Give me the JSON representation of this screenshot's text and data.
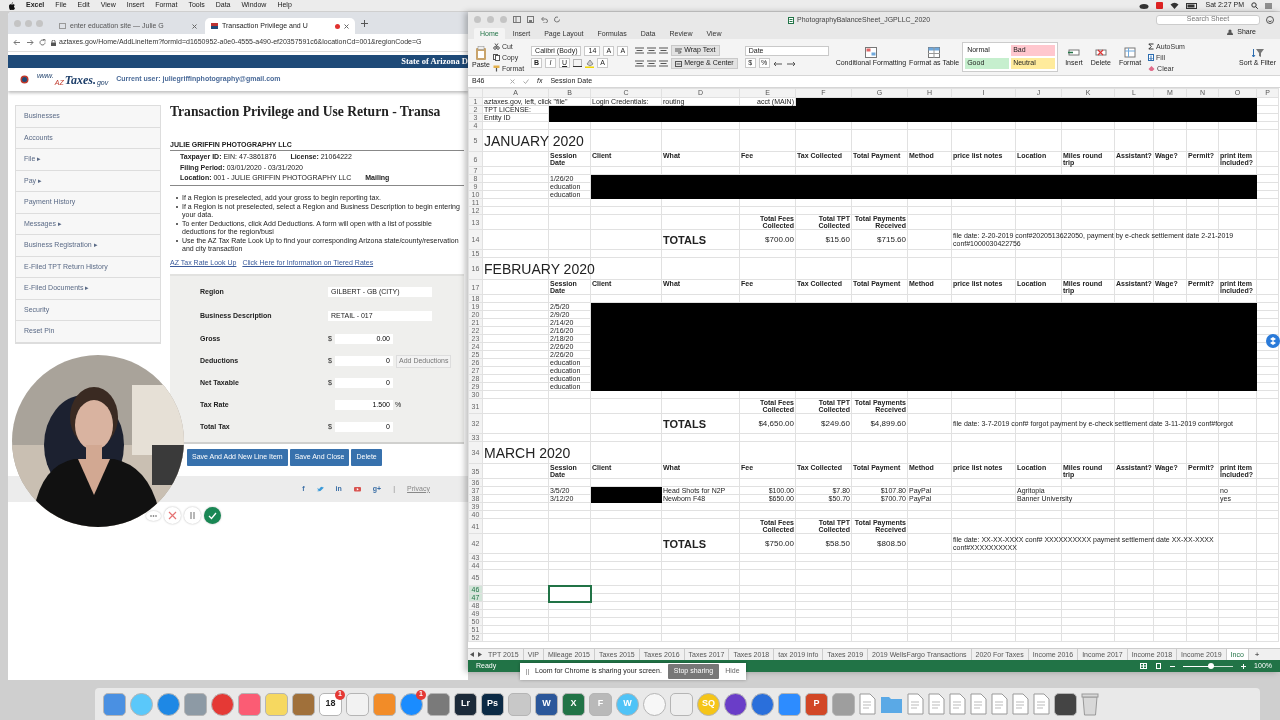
{
  "menubar": {
    "app": "Excel",
    "items": [
      "File",
      "Edit",
      "View",
      "Insert",
      "Format",
      "Tools",
      "Data",
      "Window",
      "Help"
    ],
    "clock": "Sat 2:27 PM"
  },
  "browser": {
    "tabs": [
      {
        "title": "enter education site — Julie G",
        "selected": false,
        "recording": false
      },
      {
        "title": "Transaction Privilege and U",
        "selected": true,
        "recording": true
      }
    ],
    "url": "aztaxes.gov/Home/AddLineItem?formId=d1650952-a0e0-4555-a490-ef20357591c6&locationCd=001&regionCode=G",
    "banner": "State of Arizona D",
    "logo": {
      "prefix": "www.",
      "mark": "AZ",
      "name": "Taxes.",
      "suffix": "gov"
    },
    "current_user": "Current user: juliegriffinphotography@gmail.com",
    "sidebar": [
      "Businesses",
      "Accounts",
      "File ▸",
      "Pay ▸",
      "Payment History",
      "Messages ▸",
      "Business Registration ▸",
      "E-Filed TPT Return History",
      "E-Filed Documents ▸",
      "Security",
      "Reset Pin"
    ],
    "page_title": "Transaction Privilege and Use Return - Transa",
    "business": "JULIE GRIFFIN PHOTOGRAPHY LLC",
    "info": [
      [
        {
          "label": "Taxpayer ID:",
          "value": "EIN: 47-3861876"
        },
        {
          "label": "License:",
          "value": "21064222"
        }
      ],
      [
        {
          "label": "Filing Period:",
          "value": "03/01/2020 - 03/31/2020"
        },
        {
          "label": "Location:",
          "value": "001 - JULIE GRIFFIN PHOTOGRAPHY LLC"
        },
        {
          "label": "Mailing"
        }
      ]
    ],
    "instructions": [
      "If a Region is preselected, add your gross to begin reporting tax.",
      "If a Region is not preselected, select a Region and Business Description to begin entering your data.",
      "To enter Deductions, click Add Deductions. A form will open with a list of possible deductions for the region/busi",
      "Use the AZ Tax Rate Look Up to find your corresponding Arizona state/county/reservation and city transaction"
    ],
    "links": [
      "AZ Tax Rate Look Up",
      "Click Here for Information on Tiered Rates"
    ],
    "selects": [
      {
        "label": "Region",
        "value": "GILBERT - GB (CITY)"
      },
      {
        "label": "Business Description",
        "value": "RETAIL - 017"
      }
    ],
    "amounts": [
      {
        "label": "Gross",
        "prefix": "$",
        "value": "0.00"
      },
      {
        "label": "Deductions",
        "prefix": "$",
        "value": "0",
        "action": "Add Deductions"
      },
      {
        "label": "Net Taxable",
        "prefix": "$",
        "value": "0"
      },
      {
        "label": "Tax Rate",
        "value": "1.500",
        "suffix": "%"
      },
      {
        "label": "Total Tax",
        "prefix": "$",
        "value": "0"
      }
    ],
    "buttons": [
      "Save And Add New Line Item",
      "Save And Close",
      "Delete"
    ],
    "social": [
      {
        "kind": "glyph",
        "text": "f"
      },
      {
        "kind": "bird"
      },
      {
        "kind": "glyph",
        "text": "in"
      },
      {
        "kind": "play"
      },
      {
        "kind": "glyph",
        "text": "g+"
      }
    ],
    "separator": "|",
    "privacy": "Privacy"
  },
  "recorder": {
    "kind": "picture",
    "controls": [
      {
        "kind": "more"
      },
      {
        "kind": "cancel"
      },
      {
        "kind": "pause"
      },
      {
        "kind": "done"
      }
    ]
  },
  "excel": {
    "title": "PhotographyBalanceSheet_JGPLLC_2020",
    "search": {
      "placeholder": "Search Sheet"
    },
    "tabs": [
      {
        "label": "Home",
        "selected": true
      },
      {
        "label": "Insert",
        "selected": false
      },
      {
        "label": "Page Layout",
        "selected": false
      },
      {
        "label": "Formulas",
        "selected": false
      },
      {
        "label": "Data",
        "selected": false
      },
      {
        "label": "Review",
        "selected": false
      },
      {
        "label": "View",
        "selected": false
      }
    ],
    "share": "Share",
    "clipboard": {
      "paste": "Paste",
      "items": [
        "Cut",
        "Copy",
        "Format"
      ]
    },
    "font": {
      "name": "Calibri (Body)",
      "size": "14",
      "grow": [
        "A",
        "A"
      ],
      "styles": [
        "B",
        "I",
        "U"
      ],
      "color_button": "A"
    },
    "alignment": {
      "wrap": "Wrap Text",
      "merge": "Merge & Center"
    },
    "number": {
      "format": "Date",
      "buttons": [
        "$",
        "%"
      ]
    },
    "styles": {
      "conditional": "Conditional Formatting",
      "table": "Format as Table",
      "cells": [
        {
          "label": "Normal",
          "color": "#ffffff"
        },
        {
          "label": "Bad",
          "color": "#ffc7ce"
        },
        {
          "label": "Good",
          "color": "#c6efce"
        },
        {
          "label": "Neutral",
          "color": "#ffeb9c"
        }
      ]
    },
    "cells": [
      "Insert",
      "Delete",
      "Format"
    ],
    "editing": {
      "autosum": "AutoSum",
      "fill": "Fill",
      "clear": "Clear",
      "sort": "Sort & Filter"
    },
    "name_box": "B46",
    "fx": "fx",
    "formula": "Session Date",
    "columns": [
      "A",
      "B",
      "C",
      "D",
      "E",
      "F",
      "G",
      "H",
      "I",
      "J",
      "K",
      "L",
      "M",
      "N",
      "O",
      "P"
    ],
    "selection": {
      "B": true
    },
    "rows": [
      {
        "n": "1",
        "kind": "data",
        "selected": false,
        "cells": {
          "A": "aztaxes.gov, left, click \"file\"",
          "C": "Login Credentials:",
          "D": "routing",
          "E": "acct (MAIN)"
        },
        "redacted": {
          "F": true,
          "O": true
        }
      },
      {
        "n": "2",
        "kind": "data",
        "selected": false,
        "cells": {
          "A": "TPT LICENSE:"
        },
        "redacted": {
          "B": true,
          "O": true
        }
      },
      {
        "n": "3",
        "kind": "data",
        "selected": false,
        "cells": {
          "A": "Entity ID"
        },
        "redacted": {
          "B": true,
          "O": true
        }
      },
      {
        "n": "4",
        "kind": "data",
        "selected": false,
        "cells": {}
      },
      {
        "n": "5",
        "kind": "title",
        "selected": false,
        "cells": {
          "A": "JANUARY 2020"
        }
      },
      {
        "n": "6",
        "kind": "header",
        "selected": false,
        "cells": {
          "B": "Session Date",
          "C": "Client",
          "D": "What",
          "E": "Fee",
          "F": "Tax Collected",
          "G": "Total Payment",
          "H": "Method",
          "I": "price list notes",
          "J": "Location",
          "K": "Miles round trip",
          "L": "Assistant?",
          "M": "Wage?",
          "N": "Permit?",
          "O": "print item included?"
        }
      },
      {
        "n": "7",
        "kind": "data",
        "selected": false,
        "cells": {}
      },
      {
        "n": "8",
        "kind": "data",
        "selected": false,
        "cells": {
          "B": "1/26/20"
        },
        "redacted": {
          "C": true,
          "O": true
        }
      },
      {
        "n": "9",
        "kind": "data",
        "selected": false,
        "cells": {
          "B": "education"
        },
        "redacted": {
          "C": true,
          "O": true
        }
      },
      {
        "n": "10",
        "kind": "data",
        "selected": false,
        "cells": {
          "B": "education"
        },
        "redacted": {
          "C": true,
          "O": true
        }
      },
      {
        "n": "11",
        "kind": "data",
        "selected": false,
        "cells": {}
      },
      {
        "n": "12",
        "kind": "data",
        "selected": false,
        "cells": {}
      },
      {
        "n": "13",
        "kind": "labels",
        "selected": false,
        "cells": {
          "E": "Total Fees Collected",
          "F": "Total TPT Collected",
          "G": "Total Payments Received"
        }
      },
      {
        "n": "14",
        "kind": "totals",
        "selected": false,
        "cells": {
          "D": "TOTALS",
          "E": "$700.00",
          "F": "$15.60",
          "G": "$715.60",
          "I": "file date:  2-20-2019 conf#2020513622050, payment by e-check settlement date 2-21-2019 conf#1000030422756"
        }
      },
      {
        "n": "15",
        "kind": "data",
        "selected": false,
        "cells": {}
      },
      {
        "n": "16",
        "kind": "title",
        "selected": false,
        "cells": {
          "A": "FEBRUARY 2020"
        }
      },
      {
        "n": "17",
        "kind": "header",
        "selected": false,
        "cells": {
          "B": "Session Date",
          "C": "Client",
          "D": "What",
          "E": "Fee",
          "F": "Tax Collected",
          "G": "Total Payment",
          "H": "Method",
          "I": "price list notes",
          "J": "Location",
          "K": "Miles round trip",
          "L": "Assistant?",
          "M": "Wage?",
          "N": "Permit?",
          "O": "print item included?"
        }
      },
      {
        "n": "18",
        "kind": "data",
        "selected": false,
        "cells": {}
      },
      {
        "n": "19",
        "kind": "data",
        "selected": false,
        "cells": {
          "B": "2/5/20"
        },
        "redacted": {
          "C": true,
          "O": true
        }
      },
      {
        "n": "20",
        "kind": "data",
        "selected": false,
        "cells": {
          "B": "2/9/20"
        },
        "redacted": {
          "C": true,
          "O": true
        }
      },
      {
        "n": "21",
        "kind": "data",
        "selected": false,
        "cells": {
          "B": "2/14/20"
        },
        "redacted": {
          "C": true,
          "O": true
        }
      },
      {
        "n": "22",
        "kind": "data",
        "selected": false,
        "cells": {
          "B": "2/16/20"
        },
        "redacted": {
          "C": true,
          "O": true
        }
      },
      {
        "n": "23",
        "kind": "data",
        "selected": false,
        "cells": {
          "B": "2/18/20"
        },
        "redacted": {
          "C": true,
          "O": true
        }
      },
      {
        "n": "24",
        "kind": "data",
        "selected": false,
        "cells": {
          "B": "2/26/20"
        },
        "redacted": {
          "C": true,
          "O": true
        }
      },
      {
        "n": "25",
        "kind": "data",
        "selected": false,
        "cells": {
          "B": "2/26/20"
        },
        "redacted": {
          "C": true,
          "O": true
        }
      },
      {
        "n": "26",
        "kind": "data",
        "selected": false,
        "cells": {
          "B": "education"
        },
        "redacted": {
          "C": true,
          "O": true
        }
      },
      {
        "n": "27",
        "kind": "data",
        "selected": false,
        "cells": {
          "B": "education"
        },
        "redacted": {
          "C": true,
          "O": true
        }
      },
      {
        "n": "28",
        "kind": "data",
        "selected": false,
        "cells": {
          "B": "education"
        },
        "redacted": {
          "C": true,
          "O": true
        }
      },
      {
        "n": "29",
        "kind": "data",
        "selected": false,
        "cells": {
          "B": "education"
        },
        "redacted": {
          "C": true,
          "O": true
        }
      },
      {
        "n": "30",
        "kind": "data",
        "selected": false,
        "cells": {}
      },
      {
        "n": "31",
        "kind": "labels",
        "selected": false,
        "cells": {
          "E": "Total Fees Collected",
          "F": "Total TPT Collected",
          "G": "Total Payments Received"
        }
      },
      {
        "n": "32",
        "kind": "totals",
        "selected": false,
        "cells": {
          "D": "TOTALS",
          "E": "$4,650.00",
          "F": "$249.60",
          "G": "$4,899.60",
          "I": "file date:  3-7-2019 conf# forgot  payment by e-check settlement date 3-11-2019 conf#forgot"
        }
      },
      {
        "n": "33",
        "kind": "data",
        "selected": false,
        "cells": {}
      },
      {
        "n": "34",
        "kind": "title",
        "selected": false,
        "cells": {
          "A": "MARCH 2020"
        }
      },
      {
        "n": "35",
        "kind": "header",
        "selected": false,
        "cells": {
          "B": "Session Date",
          "C": "Client",
          "D": "What",
          "E": "Fee",
          "F": "Tax Collected",
          "G": "Total Payment",
          "H": "Method",
          "I": "price list notes",
          "J": "Location",
          "K": "Miles round trip",
          "L": "Assistant?",
          "M": "Wage?",
          "N": "Permit?",
          "O": "print item included?"
        }
      },
      {
        "n": "36",
        "kind": "data",
        "selected": false,
        "cells": {}
      },
      {
        "n": "37",
        "kind": "data",
        "selected": false,
        "cells": {
          "B": "3/5/20",
          "D": "Head Shots for N2P",
          "E": "$100.00",
          "F": "$7.80",
          "G": "$107.80",
          "H": "PayPal",
          "J": "Agritopia",
          "O": "no"
        },
        "redacted": {
          "C": true
        }
      },
      {
        "n": "38",
        "kind": "data",
        "selected": false,
        "cells": {
          "B": "3/12/20",
          "D": "Newborn F48",
          "E": "$650.00",
          "F": "$50.70",
          "G": "$700.70",
          "H": "PayPal",
          "J": "Banner University",
          "O": "yes"
        },
        "redacted": {
          "C": true
        }
      },
      {
        "n": "39",
        "kind": "data",
        "selected": false,
        "cells": {}
      },
      {
        "n": "40",
        "kind": "data",
        "selected": false,
        "cells": {}
      },
      {
        "n": "41",
        "kind": "labels",
        "selected": false,
        "cells": {
          "E": "Total Fees Collected",
          "F": "Total TPT Collected",
          "G": "Total Payments Received"
        }
      },
      {
        "n": "42",
        "kind": "totals",
        "selected": false,
        "cells": {
          "D": "TOTALS",
          "E": "$750.00",
          "F": "$58.50",
          "G": "$808.50",
          "I": "file date: XX-XX-XXXX   conf# XXXXXXXXXX  payment settlement date XX-XX-XXXX   conf#XXXXXXXXXX"
        }
      },
      {
        "n": "43",
        "kind": "data",
        "selected": false,
        "cells": {}
      },
      {
        "n": "44",
        "kind": "data",
        "selected": false,
        "cells": {}
      },
      {
        "n": "45",
        "kind": "tall",
        "selected": false,
        "cells": {}
      },
      {
        "n": "46",
        "kind": "data",
        "selected": true,
        "cells": {}
      },
      {
        "n": "47",
        "kind": "data",
        "selected": true,
        "cells": {}
      },
      {
        "n": "48",
        "kind": "data",
        "selected": false,
        "cells": {}
      },
      {
        "n": "49",
        "kind": "data",
        "selected": false,
        "cells": {}
      },
      {
        "n": "50",
        "kind": "data",
        "selected": false,
        "cells": {}
      },
      {
        "n": "51",
        "kind": "data",
        "selected": false,
        "cells": {}
      },
      {
        "n": "52",
        "kind": "data",
        "selected": false,
        "cells": {}
      }
    ],
    "sheets": [
      {
        "label": "TPT 2015",
        "selected": false
      },
      {
        "label": "VIP",
        "selected": false
      },
      {
        "label": "Mileage 2015",
        "selected": false
      },
      {
        "label": "Taxes 2015",
        "selected": false
      },
      {
        "label": "Taxes 2016",
        "selected": false
      },
      {
        "label": "Taxes 2017",
        "selected": false
      },
      {
        "label": "Taxes 2018",
        "selected": false
      },
      {
        "label": "tax 2019 info",
        "selected": false
      },
      {
        "label": "Taxes 2019",
        "selected": false
      },
      {
        "label": "2019 WellsFargo Transactions",
        "selected": false
      },
      {
        "label": "2020 For Taxes",
        "selected": false
      },
      {
        "label": "Income 2016",
        "selected": false
      },
      {
        "label": "Income 2017",
        "selected": false
      },
      {
        "label": "Income 2018",
        "selected": false
      },
      {
        "label": "Income 2019",
        "selected": false
      },
      {
        "label": "Inco",
        "selected": true
      }
    ],
    "add_sheet": "+",
    "status": "Ready",
    "zoom_slider": {
      "level": 0.55
    },
    "zoom": "100%"
  },
  "loom": {
    "message": "Loom for Chrome is sharing your screen.",
    "stop": "Stop sharing",
    "hide": "Hide"
  },
  "dock": [
    {
      "kind": "tile",
      "color": "#4a90e2"
    },
    {
      "kind": "round",
      "color": "#5ac8fa"
    },
    {
      "kind": "round",
      "color": "#1e88e5"
    },
    {
      "kind": "tile",
      "color": "#8d9aa5"
    },
    {
      "kind": "round",
      "color": "#e53935"
    },
    {
      "kind": "tile",
      "color": "#fb5c74"
    },
    {
      "kind": "tile",
      "color": "#f6d860"
    },
    {
      "kind": "tile",
      "color": "#a0703a"
    },
    {
      "kind": "tile",
      "color": "#ffffff",
      "label": "18",
      "badge": "1"
    },
    {
      "kind": "tile",
      "color": "#f2f2f2"
    },
    {
      "kind": "tile",
      "color": "#f28c28"
    },
    {
      "kind": "round",
      "color": "#1a8cff",
      "badge": "1"
    },
    {
      "kind": "tile",
      "color": "#7a7a7a"
    },
    {
      "kind": "tile",
      "color": "#1c2a39",
      "label": "Lr"
    },
    {
      "kind": "tile",
      "color": "#0b2a45",
      "label": "Ps"
    },
    {
      "kind": "tile",
      "color": "#c8c8c8"
    },
    {
      "kind": "tile",
      "color": "#2b579a",
      "label": "W"
    },
    {
      "kind": "tile",
      "color": "#217346",
      "label": "X"
    },
    {
      "kind": "tile",
      "color": "#b9b9b9",
      "label": "F"
    },
    {
      "kind": "round",
      "color": "#4fc3f7",
      "label": "W"
    },
    {
      "kind": "round",
      "color": "#f7f7f7"
    },
    {
      "kind": "tile",
      "color": "#eeeeee"
    },
    {
      "kind": "round",
      "color": "#f5c518",
      "label": "SQ"
    },
    {
      "kind": "round",
      "color": "#6a3dc8"
    },
    {
      "kind": "round",
      "color": "#2a6fdb"
    },
    {
      "kind": "tile",
      "color": "#2d8cff"
    },
    {
      "kind": "tile",
      "color": "#d24726",
      "label": "P"
    },
    {
      "kind": "tile",
      "color": "#9e9e9e"
    },
    {
      "kind": "doc",
      "color": "#ffffff"
    },
    {
      "kind": "folder",
      "color": "#5aa9e6"
    },
    {
      "kind": "doc",
      "color": "#ffffff"
    },
    {
      "kind": "doc",
      "color": "#ffffff"
    },
    {
      "kind": "doc",
      "color": "#ffffff"
    },
    {
      "kind": "doc",
      "color": "#ffffff"
    },
    {
      "kind": "doc",
      "color": "#ffffff"
    },
    {
      "kind": "doc",
      "color": "#ffffff"
    },
    {
      "kind": "doc",
      "color": "#ffffff"
    },
    {
      "kind": "tile",
      "color": "#444444"
    },
    {
      "kind": "trash",
      "color": "#d8d8d8"
    }
  ]
}
